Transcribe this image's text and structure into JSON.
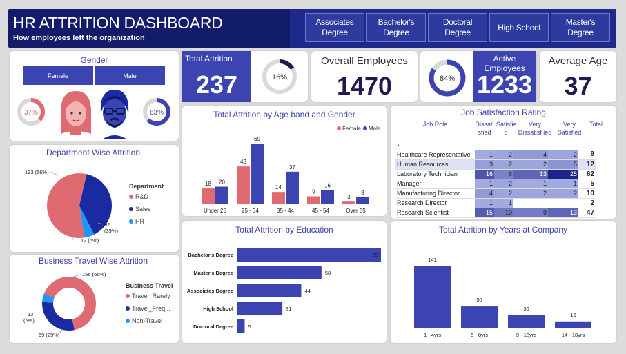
{
  "header": {
    "title": "HR ATTRITION DASHBOARD",
    "subtitle": "How employees left the organization",
    "education_filters": [
      {
        "line1": "Associates",
        "line2": "Degree"
      },
      {
        "line1": "Bachelor's",
        "line2": "Degree"
      },
      {
        "line1": "Doctoral",
        "line2": "Degree"
      },
      {
        "line1": "High School",
        "line2": ""
      },
      {
        "line1": "Master's",
        "line2": "Degree"
      }
    ]
  },
  "gender": {
    "title": "Gender",
    "female_label": "Female",
    "male_label": "Male",
    "female_pct": "37%",
    "male_pct": "63%",
    "female_fraction": 0.37,
    "male_fraction": 0.63
  },
  "kpis": {
    "total_attrition_label": "Total Attrition",
    "total_attrition_value": "237",
    "total_attrition_pct": "16%",
    "total_attrition_fraction": 0.16,
    "overall_employees_label": "Overall Employees",
    "overall_employees_value": "1470",
    "active_employees_label": "Active Employees",
    "active_employees_value": "1233",
    "active_pct": "84%",
    "active_fraction": 0.84,
    "average_age_label": "Average Age",
    "average_age_value": "37"
  },
  "colors": {
    "navy": "#131b6b",
    "blue": "#3b44b0",
    "dark_blue": "#1a2aa0",
    "pink": "#e06a72",
    "light_blue": "#2196f3",
    "grey_ring": "#d9d9d9"
  },
  "chart_data": [
    {
      "id": "age_gender",
      "type": "bar",
      "title": "Total Attrition by Age band and Gender",
      "categories": [
        "Under 25",
        "25 - 34",
        "35 - 44",
        "45 - 54",
        "Over 55"
      ],
      "series": [
        {
          "name": "Female",
          "values": [
            18,
            43,
            14,
            9,
            3
          ]
        },
        {
          "name": "Male",
          "values": [
            20,
            69,
            37,
            16,
            8
          ]
        }
      ],
      "legend": "top-right"
    },
    {
      "id": "department",
      "type": "pie",
      "title": "Department Wise Attrition",
      "legend_title": "Department",
      "slices": [
        {
          "label": "R&D",
          "value": 133,
          "text": "133 (56%)"
        },
        {
          "label": "Sales",
          "value": 92,
          "text": "92 (39%)"
        },
        {
          "label": "HR",
          "value": 12,
          "text": "12 (5%)"
        }
      ],
      "legend": "right"
    },
    {
      "id": "business_travel",
      "type": "pie",
      "title": "Business Travel Wise Attrition",
      "legend_title": "Business Travel",
      "slices": [
        {
          "label": "Travel_Rarely",
          "value": 156,
          "text": "156 (66%)"
        },
        {
          "label": "Travel_Freq...",
          "value": 69,
          "text": "69 (29%)"
        },
        {
          "label": "Non-Travel",
          "value": 12,
          "text": "12 (5%)"
        }
      ],
      "legend": "right"
    },
    {
      "id": "education",
      "type": "bar",
      "orientation": "horizontal",
      "title": "Total Attrition by Education",
      "categories": [
        "Bachelor's Degree",
        "Master's Degree",
        "Associates Degree",
        "High School",
        "Doctoral Degree"
      ],
      "values": [
        99,
        58,
        44,
        31,
        5
      ]
    },
    {
      "id": "years_at_company",
      "type": "bar",
      "title": "Total Attrition by Years at Company",
      "categories": [
        "1 - 4yrs",
        "5 - 8yrs",
        "9 - 13yrs",
        "14 - 18yrs"
      ],
      "values": [
        141,
        50,
        30,
        16
      ]
    },
    {
      "id": "job_satisfaction",
      "type": "table",
      "title": "Job Satisfaction Rating",
      "columns": [
        "Job Role",
        "Dissati sfied",
        "Satisfie d",
        "Very Dissatisf ied",
        "Very Satisfied",
        "Total"
      ],
      "rows": [
        {
          "role": "Healthcare Representative",
          "values": [
            1,
            2,
            4,
            2
          ],
          "total": 9
        },
        {
          "role": "Human Resources",
          "values": [
            3,
            2,
            2,
            5
          ],
          "total": 12
        },
        {
          "role": "Laboratory Technician",
          "values": [
            16,
            8,
            13,
            25
          ],
          "total": 62
        },
        {
          "role": "Manager",
          "values": [
            1,
            2,
            1,
            1
          ],
          "total": 5
        },
        {
          "role": "Manufacturing Director",
          "values": [
            4,
            2,
            2,
            2
          ],
          "total": 10
        },
        {
          "role": "Research Director",
          "values": [
            1,
            1,
            null,
            null
          ],
          "total": 2
        },
        {
          "role": "Research Scientist",
          "values": [
            15,
            10,
            9,
            13
          ],
          "total": 47
        }
      ]
    }
  ]
}
